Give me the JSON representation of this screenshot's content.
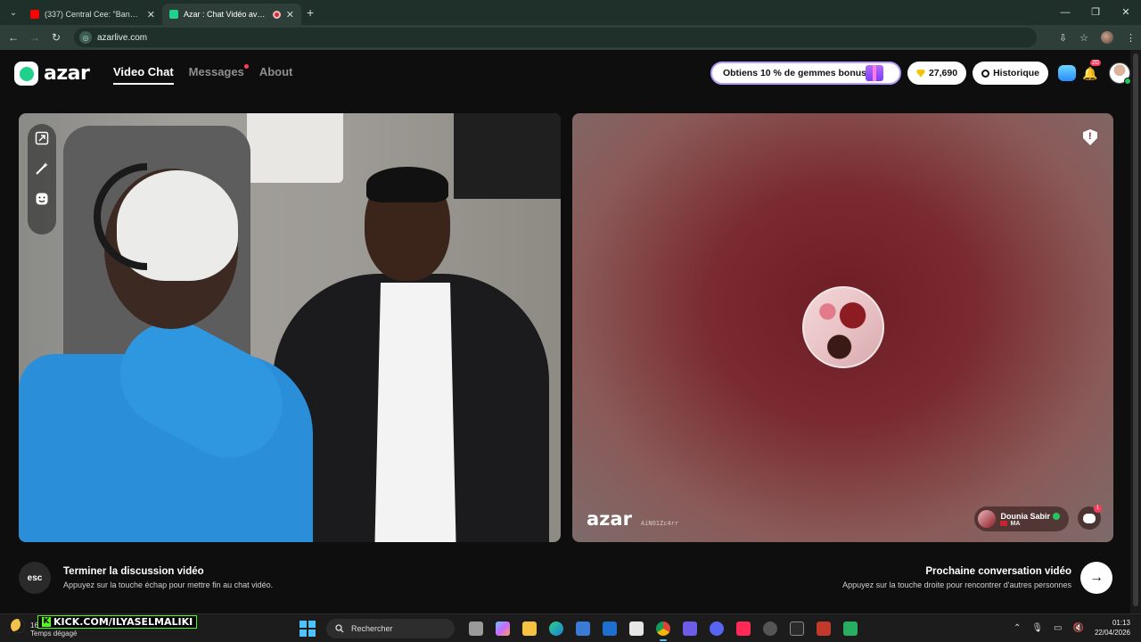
{
  "browser": {
    "tabs": [
      {
        "title": "(337) Central Cee: \"Band4Band\"",
        "favicon_color": "#ff0000",
        "active": false
      },
      {
        "title": "Azar : Chat Vidéo avec de n",
        "favicon_color": "#1fd18a",
        "active": true
      }
    ],
    "url": "azarlive.com"
  },
  "app": {
    "logo_text": "azar",
    "nav": [
      {
        "label": "Video Chat",
        "active": true
      },
      {
        "label": "Messages",
        "has_dot": true
      },
      {
        "label": "About"
      }
    ],
    "promo_label": "Obtiens 10 % de gemmes bonus !",
    "gems": "27,690",
    "history_label": "Historique",
    "notifications_count": "20"
  },
  "partner": {
    "name": "Dounia Sabir",
    "country": "MA",
    "watermark_logo": "azar",
    "watermark_id": "AiNO1Zc4rr",
    "chat_unread": "1"
  },
  "hints": {
    "end_key": "esc",
    "end_title": "Terminer la discussion vidéo",
    "end_sub": "Appuyez sur la touche échap pour mettre fin au chat vidéo.",
    "next_title": "Prochaine conversation vidéo",
    "next_sub": "Appuyez sur la touche droite pour rencontrer d'autres personnes",
    "next_key_glyph": "→"
  },
  "taskbar": {
    "weather_temp": "16",
    "weather_desc": "Temps dégagé",
    "overlay_text": "KICK.COM/ILYASELMALIKI",
    "search_placeholder": "Rechercher",
    "time": "01:13",
    "date": "22/04/2026"
  },
  "colors": {
    "accent": "#1fd18a",
    "badge": "#ff3b5c",
    "promo_border": "#b69cff"
  }
}
